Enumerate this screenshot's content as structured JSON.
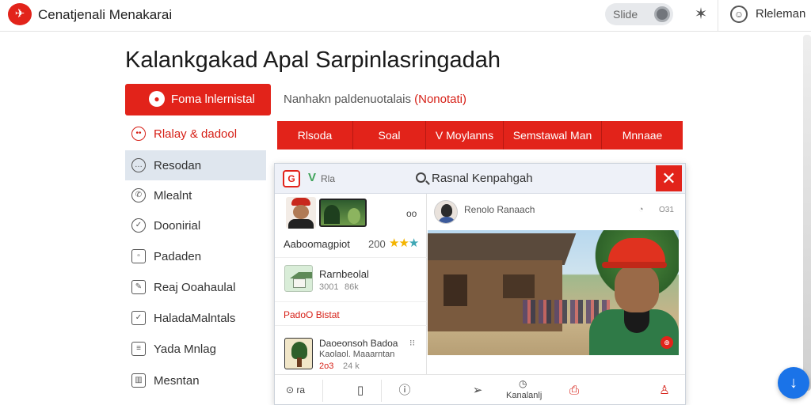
{
  "header": {
    "logo_text": "✈",
    "app_title": "Cenatjenali Menakarai",
    "slide_label": "Slide",
    "user_label": "Rleleman"
  },
  "page": {
    "title": "Kalankgakad Apal Sarpinlasringadah",
    "primary_button": "Foma lnlernistal",
    "subline_prefix": "Nanhakn paldenuotalais",
    "subline_red": "(Nonotati)"
  },
  "sidebar": {
    "items": [
      {
        "label": "Rlalay & dadool",
        "icon": "smile-icon"
      },
      {
        "label": "Resodan",
        "icon": "chat-icon"
      },
      {
        "label": "Mlealnt",
        "icon": "phone-icon"
      },
      {
        "label": "Doonirial",
        "icon": "compass-icon"
      },
      {
        "label": "Padaden",
        "icon": "image-icon"
      },
      {
        "label": "Reaj Ooahaulal",
        "icon": "edit-icon"
      },
      {
        "label": "HaladaMalntals",
        "icon": "checkbox-icon"
      },
      {
        "label": "Yada Mnlag",
        "icon": "list-icon"
      },
      {
        "label": "Mesntan",
        "icon": "grid-icon"
      }
    ]
  },
  "tabs": [
    "Rlsoda",
    "Soal",
    "V Moylanns",
    "Semstawal Man",
    "Mnnaae"
  ],
  "window": {
    "logo_text": "G",
    "v_mark": "V",
    "small_label": "Rla",
    "search_text": "Rasnal Kenpahgah",
    "close_label": "✕",
    "left_list": {
      "top_badge": "oo",
      "item1_title": "Aaboomagpiot",
      "item1_count": "200",
      "item1_stars": "★★",
      "item1_star_teal": "★",
      "item2_title": "Rarnbeolal",
      "item2_meta1": "3001",
      "item2_meta2": "86k",
      "section_label": "PadoO Bistat",
      "item3_title": "Daoeonsoh Badoa",
      "item3_sub": "Kaolaol. Maaarntan",
      "item3_meta1": "2o3",
      "item3_meta2": "24 k",
      "item3_dots": "⁝⁝"
    },
    "post": {
      "author": "Renolo Ranaach",
      "time_icon": "clock-icon",
      "time_text": "O31",
      "badge": "⊕"
    },
    "bottom_bar": {
      "item1": "⊙ ra",
      "item2_icon": "bookmark-icon",
      "item3_icon": "comment-icon",
      "item4_icon": "send-icon",
      "item5_label": "Kanalanlj",
      "item6_icon": "gift-icon",
      "item7_icon": "person-icon"
    }
  },
  "fab_label": "↓"
}
